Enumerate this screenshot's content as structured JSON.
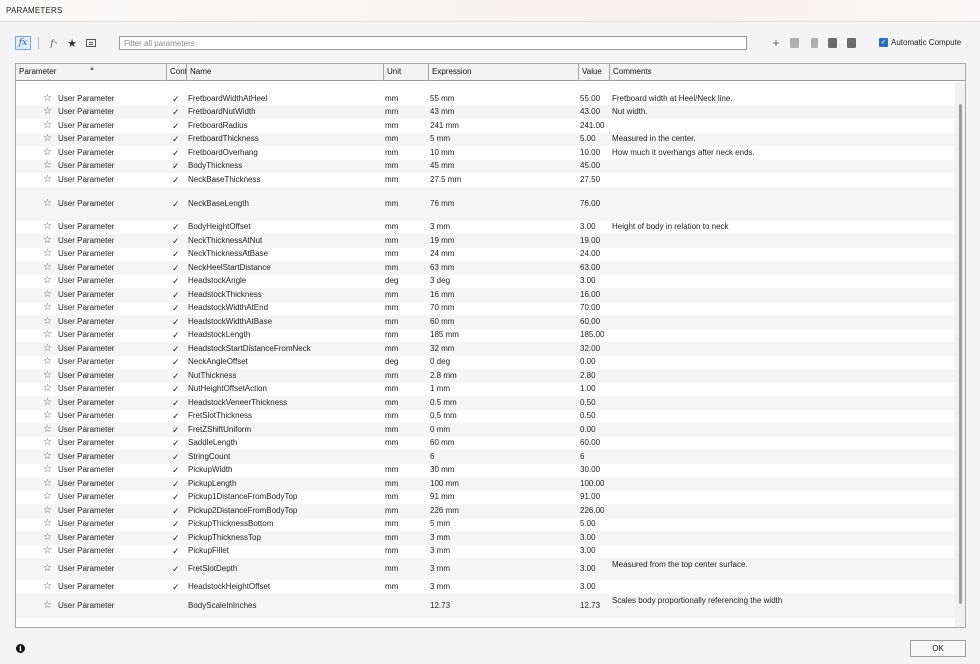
{
  "window": {
    "title": "PARAMETERS"
  },
  "toolbar": {
    "fx_icon_label": "fx",
    "user_fx_label": "f",
    "filter_placeholder": "Filter all parameters",
    "auto_compute_label": "Automatic Compute",
    "auto_compute_checked": true
  },
  "table": {
    "columns": [
      "Parameter",
      "Cont",
      "Name",
      "Unit",
      "Expression",
      "Value",
      "Comments"
    ],
    "rows": [
      {
        "type": "User Parameter",
        "check": "✓",
        "name": "FretboardWidthAtHeel",
        "unit": "mm",
        "expression": "55 mm",
        "value": "55.00",
        "comment": "Fretboard width at Heel/Neck line."
      },
      {
        "type": "User Parameter",
        "check": "✓",
        "name": "FretboardNutWidth",
        "unit": "mm",
        "expression": "43 mm",
        "value": "43.00",
        "comment": "Nut width."
      },
      {
        "type": "User Parameter",
        "check": "✓",
        "name": "FretboardRadius",
        "unit": "mm",
        "expression": "241 mm",
        "value": "241.00",
        "comment": ""
      },
      {
        "type": "User Parameter",
        "check": "✓",
        "name": "FretboardThickness",
        "unit": "mm",
        "expression": "5 mm",
        "value": "5.00",
        "comment": "Measured in the center."
      },
      {
        "type": "User Parameter",
        "check": "✓",
        "name": "FretboardOverhang",
        "unit": "mm",
        "expression": "10 mm",
        "value": "10.00",
        "comment": "How much it overhangs after neck ends."
      },
      {
        "type": "User Parameter",
        "check": "✓",
        "name": "BodyThickness",
        "unit": "mm",
        "expression": "45 mm",
        "value": "45.00",
        "comment": ""
      },
      {
        "type": "User Parameter",
        "check": "✓",
        "name": "NeckBaseThickness",
        "unit": "mm",
        "expression": "27.5 mm",
        "value": "27.50",
        "comment": ""
      },
      {
        "type": "User Parameter",
        "check": "✓",
        "name": "NeckBaseLength",
        "unit": "mm",
        "expression": "76 mm",
        "value": "76.00",
        "comment": ""
      },
      {
        "type": "User Parameter",
        "check": "✓",
        "name": "BodyHeightOffset",
        "unit": "mm",
        "expression": "3 mm",
        "value": "3.00",
        "comment": "Height of body in relation to neck"
      },
      {
        "type": "User Parameter",
        "check": "✓",
        "name": "NeckThicknessAtNut",
        "unit": "mm",
        "expression": "19 mm",
        "value": "19.00",
        "comment": ""
      },
      {
        "type": "User Parameter",
        "check": "✓",
        "name": "NeckThicknessAtBase",
        "unit": "mm",
        "expression": "24 mm",
        "value": "24.00",
        "comment": ""
      },
      {
        "type": "User Parameter",
        "check": "✓",
        "name": "NeckHeelStartDistance",
        "unit": "mm",
        "expression": "63 mm",
        "value": "63.00",
        "comment": ""
      },
      {
        "type": "User Parameter",
        "check": "✓",
        "name": "HeadstockAngle",
        "unit": "deg",
        "expression": "3 deg",
        "value": "3.00",
        "comment": ""
      },
      {
        "type": "User Parameter",
        "check": "✓",
        "name": "HeadstockThickness",
        "unit": "mm",
        "expression": "16 mm",
        "value": "16.00",
        "comment": ""
      },
      {
        "type": "User Parameter",
        "check": "✓",
        "name": "HeadstockWidthAtEnd",
        "unit": "mm",
        "expression": "70 mm",
        "value": "70.00",
        "comment": ""
      },
      {
        "type": "User Parameter",
        "check": "✓",
        "name": "HeadstockWidthAtBase",
        "unit": "mm",
        "expression": "60 mm",
        "value": "60.00",
        "comment": ""
      },
      {
        "type": "User Parameter",
        "check": "✓",
        "name": "HeadstockLength",
        "unit": "mm",
        "expression": "185 mm",
        "value": "185.00",
        "comment": ""
      },
      {
        "type": "User Parameter",
        "check": "✓",
        "name": "HeadstockStartDistanceFromNeck",
        "unit": "mm",
        "expression": "32 mm",
        "value": "32.00",
        "comment": ""
      },
      {
        "type": "User Parameter",
        "check": "✓",
        "name": "NeckAngleOffset",
        "unit": "deg",
        "expression": "0 deg",
        "value": "0.00",
        "comment": ""
      },
      {
        "type": "User Parameter",
        "check": "✓",
        "name": "NutThickness",
        "unit": "mm",
        "expression": "2.8 mm",
        "value": "2.80",
        "comment": ""
      },
      {
        "type": "User Parameter",
        "check": "✓",
        "name": "NutHeightOffsetAction",
        "unit": "mm",
        "expression": "1 mm",
        "value": "1.00",
        "comment": ""
      },
      {
        "type": "User Parameter",
        "check": "✓",
        "name": "HeadstockVeneerThickness",
        "unit": "mm",
        "expression": "0.5 mm",
        "value": "0.50",
        "comment": ""
      },
      {
        "type": "User Parameter",
        "check": "✓",
        "name": "FretSlotThickness",
        "unit": "mm",
        "expression": "0.5 mm",
        "value": "0.50",
        "comment": ""
      },
      {
        "type": "User Parameter",
        "check": "✓",
        "name": "FretZShiftUniform",
        "unit": "mm",
        "expression": "0 mm",
        "value": "0.00",
        "comment": ""
      },
      {
        "type": "User Parameter",
        "check": "✓",
        "name": "SaddleLength",
        "unit": "mm",
        "expression": "60 mm",
        "value": "60.00",
        "comment": ""
      },
      {
        "type": "User Parameter",
        "check": "✓",
        "name": "StringCount",
        "unit": "",
        "expression": "6",
        "value": "6",
        "comment": ""
      },
      {
        "type": "User Parameter",
        "check": "✓",
        "name": "PickupWidth",
        "unit": "mm",
        "expression": "30 mm",
        "value": "30.00",
        "comment": ""
      },
      {
        "type": "User Parameter",
        "check": "✓",
        "name": "PickupLength",
        "unit": "mm",
        "expression": "100 mm",
        "value": "100.00",
        "comment": ""
      },
      {
        "type": "User Parameter",
        "check": "✓",
        "name": "Pickup1DistanceFromBodyTop",
        "unit": "mm",
        "expression": "91 mm",
        "value": "91.00",
        "comment": ""
      },
      {
        "type": "User Parameter",
        "check": "✓",
        "name": "Pickup2DistanceFromBodyTop",
        "unit": "mm",
        "expression": "226 mm",
        "value": "226.00",
        "comment": ""
      },
      {
        "type": "User Parameter",
        "check": "✓",
        "name": "PickupThicknessBottom",
        "unit": "mm",
        "expression": "5 mm",
        "value": "5.00",
        "comment": ""
      },
      {
        "type": "User Parameter",
        "check": "✓",
        "name": "PickupThicknessTop",
        "unit": "mm",
        "expression": "3 mm",
        "value": "3.00",
        "comment": ""
      },
      {
        "type": "User Parameter",
        "check": "✓",
        "name": "PickupFillet",
        "unit": "mm",
        "expression": "3 mm",
        "value": "3.00",
        "comment": ""
      },
      {
        "type": "User Parameter",
        "check": "✓",
        "name": "FretSlotDepth",
        "unit": "mm",
        "expression": "3 mm",
        "value": "3.00",
        "comment": "Measured from the top center surface."
      },
      {
        "type": "User Parameter",
        "check": "✓",
        "name": "HeadstockHeightOffset",
        "unit": "mm",
        "expression": "3 mm",
        "value": "3.00",
        "comment": ""
      },
      {
        "type": "User Parameter",
        "check": "",
        "name": "BodyScaleInInches",
        "unit": "",
        "expression": "12.73",
        "value": "12.73",
        "comment": "Scales body proportionally referencing the width"
      }
    ]
  },
  "footer": {
    "ok_label": "OK",
    "info_glyph": "i"
  }
}
